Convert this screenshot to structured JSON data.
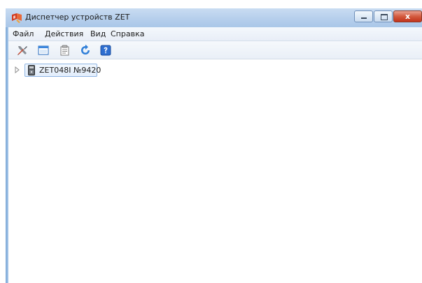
{
  "window": {
    "title": "Диспетчер устройств ZET",
    "close_glyph": "x"
  },
  "menu": {
    "items": [
      {
        "label": "Файл"
      },
      {
        "label": "Действия"
      },
      {
        "label": "Вид"
      },
      {
        "label": "Справка"
      }
    ]
  },
  "toolbar": {
    "buttons": [
      {
        "icon": "properties-icon"
      },
      {
        "icon": "window-icon"
      },
      {
        "icon": "document-icon"
      },
      {
        "icon": "refresh-icon"
      },
      {
        "icon": "help-icon"
      }
    ]
  },
  "tree": {
    "nodes": [
      {
        "label": "ZET048I №9420",
        "icon": "usb-device-icon",
        "expanded": false
      }
    ]
  },
  "colors": {
    "titlebar": "#b6cfec",
    "close_button": "#c2331b",
    "selection_border": "#8fb5e3"
  }
}
